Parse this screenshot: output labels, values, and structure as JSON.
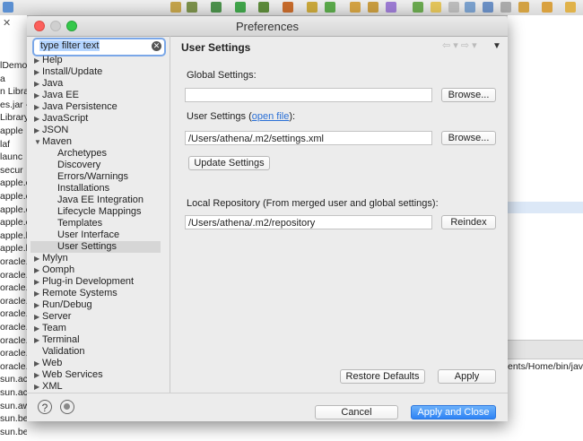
{
  "ide": {
    "left_packages": [
      "lDemo",
      "a",
      "n Librar",
      "es.jar -",
      "Library",
      "apple",
      "laf",
      "launc",
      "secur",
      "apple.c",
      "apple.e",
      "apple.e",
      "apple.e",
      "apple.l",
      "apple.l",
      "oracle.",
      "oracle.",
      "oracle.",
      "oracle.",
      "oracle.",
      "oracle.",
      "oracle.",
      "oracle.",
      "oracle.",
      "sun.ac",
      "sun.ac",
      "sun.aw",
      "sun.be",
      "sun.beans.decorat"
    ],
    "right_path": "ents/Home/bin/java"
  },
  "dialog": {
    "title": "Preferences",
    "filter": {
      "value": "type filter text"
    },
    "tree": [
      {
        "label": "Help",
        "level": 0,
        "expanded": false
      },
      {
        "label": "Install/Update",
        "level": 0,
        "expanded": false
      },
      {
        "label": "Java",
        "level": 0,
        "expanded": false
      },
      {
        "label": "Java EE",
        "level": 0,
        "expanded": false
      },
      {
        "label": "Java Persistence",
        "level": 0,
        "expanded": false
      },
      {
        "label": "JavaScript",
        "level": 0,
        "expanded": false
      },
      {
        "label": "JSON",
        "level": 0,
        "expanded": false
      },
      {
        "label": "Maven",
        "level": 0,
        "expanded": true
      },
      {
        "label": "Archetypes",
        "level": 1
      },
      {
        "label": "Discovery",
        "level": 1
      },
      {
        "label": "Errors/Warnings",
        "level": 1
      },
      {
        "label": "Installations",
        "level": 1
      },
      {
        "label": "Java EE Integration",
        "level": 1
      },
      {
        "label": "Lifecycle Mappings",
        "level": 1
      },
      {
        "label": "Templates",
        "level": 1
      },
      {
        "label": "User Interface",
        "level": 1
      },
      {
        "label": "User Settings",
        "level": 1,
        "selected": true
      },
      {
        "label": "Mylyn",
        "level": 0,
        "expanded": false
      },
      {
        "label": "Oomph",
        "level": 0,
        "expanded": false
      },
      {
        "label": "Plug-in Development",
        "level": 0,
        "expanded": false
      },
      {
        "label": "Remote Systems",
        "level": 0,
        "expanded": false
      },
      {
        "label": "Run/Debug",
        "level": 0,
        "expanded": false
      },
      {
        "label": "Server",
        "level": 0,
        "expanded": false
      },
      {
        "label": "Team",
        "level": 0,
        "expanded": false
      },
      {
        "label": "Terminal",
        "level": 0,
        "expanded": false
      },
      {
        "label": "Validation",
        "level": 0,
        "leaf": true
      },
      {
        "label": "Web",
        "level": 0,
        "expanded": false
      },
      {
        "label": "Web Services",
        "level": 0,
        "expanded": false
      },
      {
        "label": "XML",
        "level": 0,
        "expanded": false
      }
    ],
    "page": {
      "title": "User Settings",
      "global_label": "Global Settings:",
      "global_value": "",
      "browse_label": "Browse...",
      "user_label_prefix": "User Settings (",
      "user_label_link": "open file",
      "user_label_suffix": "):",
      "user_value": "/Users/athena/.m2/settings.xml",
      "update_label": "Update Settings",
      "local_label": "Local Repository (From merged user and global settings):",
      "local_value": "/Users/athena/.m2/repository",
      "reindex_label": "Reindex",
      "restore_label": "Restore Defaults",
      "apply_label": "Apply"
    },
    "footer": {
      "cancel_label": "Cancel",
      "apply_close_label": "Apply and Close"
    }
  },
  "colors": {
    "accent": "#2e83f5",
    "selection": "#d6d6d6",
    "close": "#fc605c",
    "minimize": "#fdbc40",
    "zoom": "#34c84a"
  }
}
